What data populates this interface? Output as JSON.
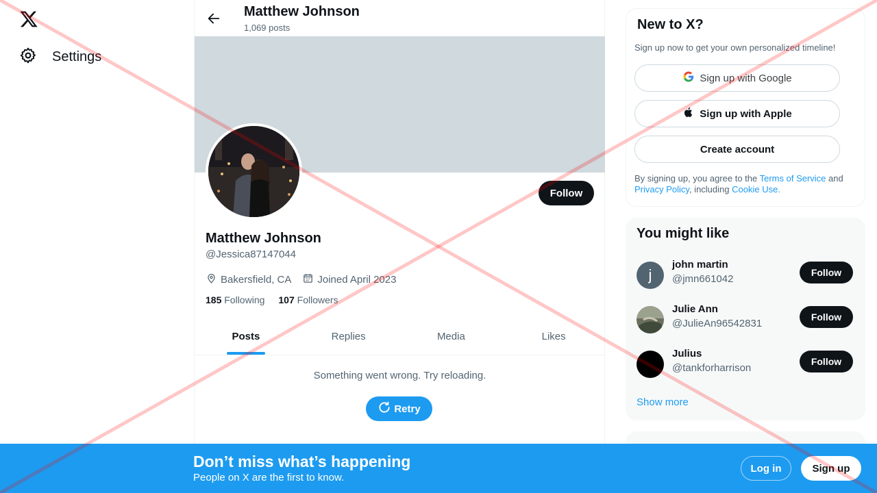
{
  "nav": {
    "settings_label": "Settings"
  },
  "header": {
    "name": "Matthew Johnson",
    "posts_count": "1,069 posts"
  },
  "profile": {
    "name": "Matthew Johnson",
    "handle": "@Jessica87147044",
    "location": "Bakersfield, CA",
    "joined": "Joined April 2023",
    "following_count": "185",
    "following_label": "Following",
    "followers_count": "107",
    "followers_label": "Followers",
    "follow_label": "Follow"
  },
  "tabs": [
    {
      "label": "Posts",
      "active": true
    },
    {
      "label": "Replies",
      "active": false
    },
    {
      "label": "Media",
      "active": false
    },
    {
      "label": "Likes",
      "active": false
    }
  ],
  "feed": {
    "error": "Something went wrong. Try reloading.",
    "retry_label": "Retry"
  },
  "signup_box": {
    "title": "New to X?",
    "subtitle": "Sign up now to get your own personalized timeline!",
    "google_label": "Sign up with Google",
    "apple_label": "Sign up with Apple",
    "create_label": "Create account",
    "terms_pre": "By signing up, you agree to the ",
    "terms_link": "Terms of Service",
    "terms_and": " and",
    "privacy_link": "Privacy Policy",
    "including": ", including ",
    "cookie_link": "Cookie Use",
    "period": "."
  },
  "who_to_follow": {
    "title": "You might like",
    "users": [
      {
        "name": "john martin",
        "handle": "@jmn661042",
        "avatar_letter": "j",
        "follow_label": "Follow"
      },
      {
        "name": "Julie Ann",
        "handle": "@JulieAn96542831",
        "follow_label": "Follow"
      },
      {
        "name": "Julius",
        "handle": "@tankforharrison",
        "follow_label": "Follow"
      }
    ],
    "show_more": "Show more"
  },
  "bottom_bar": {
    "title": "Don’t miss what’s happening",
    "subtitle": "People on X are the first to know.",
    "login_label": "Log in",
    "signup_label": "Sign up"
  },
  "colors": {
    "accent": "#1d9bf0",
    "dark": "#0f1419",
    "muted": "#536471",
    "banner": "#cfd9de",
    "overlay_line": "#ff0000"
  },
  "icons": [
    "x-logo-icon",
    "gear-icon",
    "back-arrow-icon",
    "location-pin-icon",
    "calendar-icon",
    "refresh-icon",
    "google-icon",
    "apple-icon"
  ]
}
